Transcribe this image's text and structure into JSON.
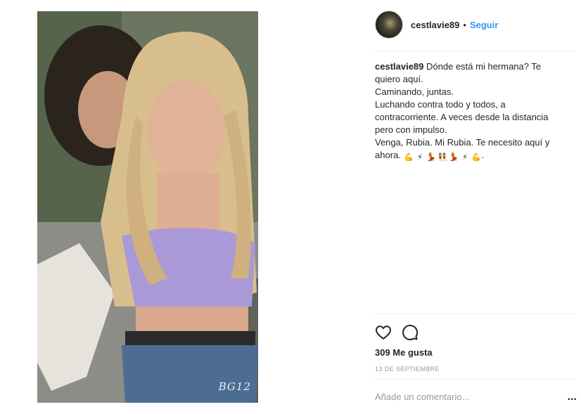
{
  "post": {
    "username": "cestlavie89",
    "separator": "•",
    "follow_label": "Seguir",
    "watermark": "BG12"
  },
  "caption": {
    "username": "cestlavie89",
    "lines": [
      "Dónde está mi hermana? Te quiero aquí.",
      "Caminando, juntas.",
      "Luchando contra todo y todos, a contracorriente. A veces desde la distancia pero con impulso.",
      "Venga, Rubia. Mi Rubia. Te necesito aquí y ahora."
    ],
    "trailing": ".",
    "emojis": [
      "flexed-biceps",
      "high-voltage",
      "woman-dancing",
      "women-with-bunny-ears",
      "woman-dancing",
      "high-voltage",
      "flexed-biceps"
    ]
  },
  "stats": {
    "likes": "309 Me gusta",
    "date": "13 DE SEPTIEMBRE"
  },
  "comment": {
    "placeholder": "Añade un comentario...",
    "more_label": "..."
  },
  "colors": {
    "link": "#3897f0",
    "text": "#262626",
    "muted": "#999999",
    "divider": "#efefef"
  }
}
